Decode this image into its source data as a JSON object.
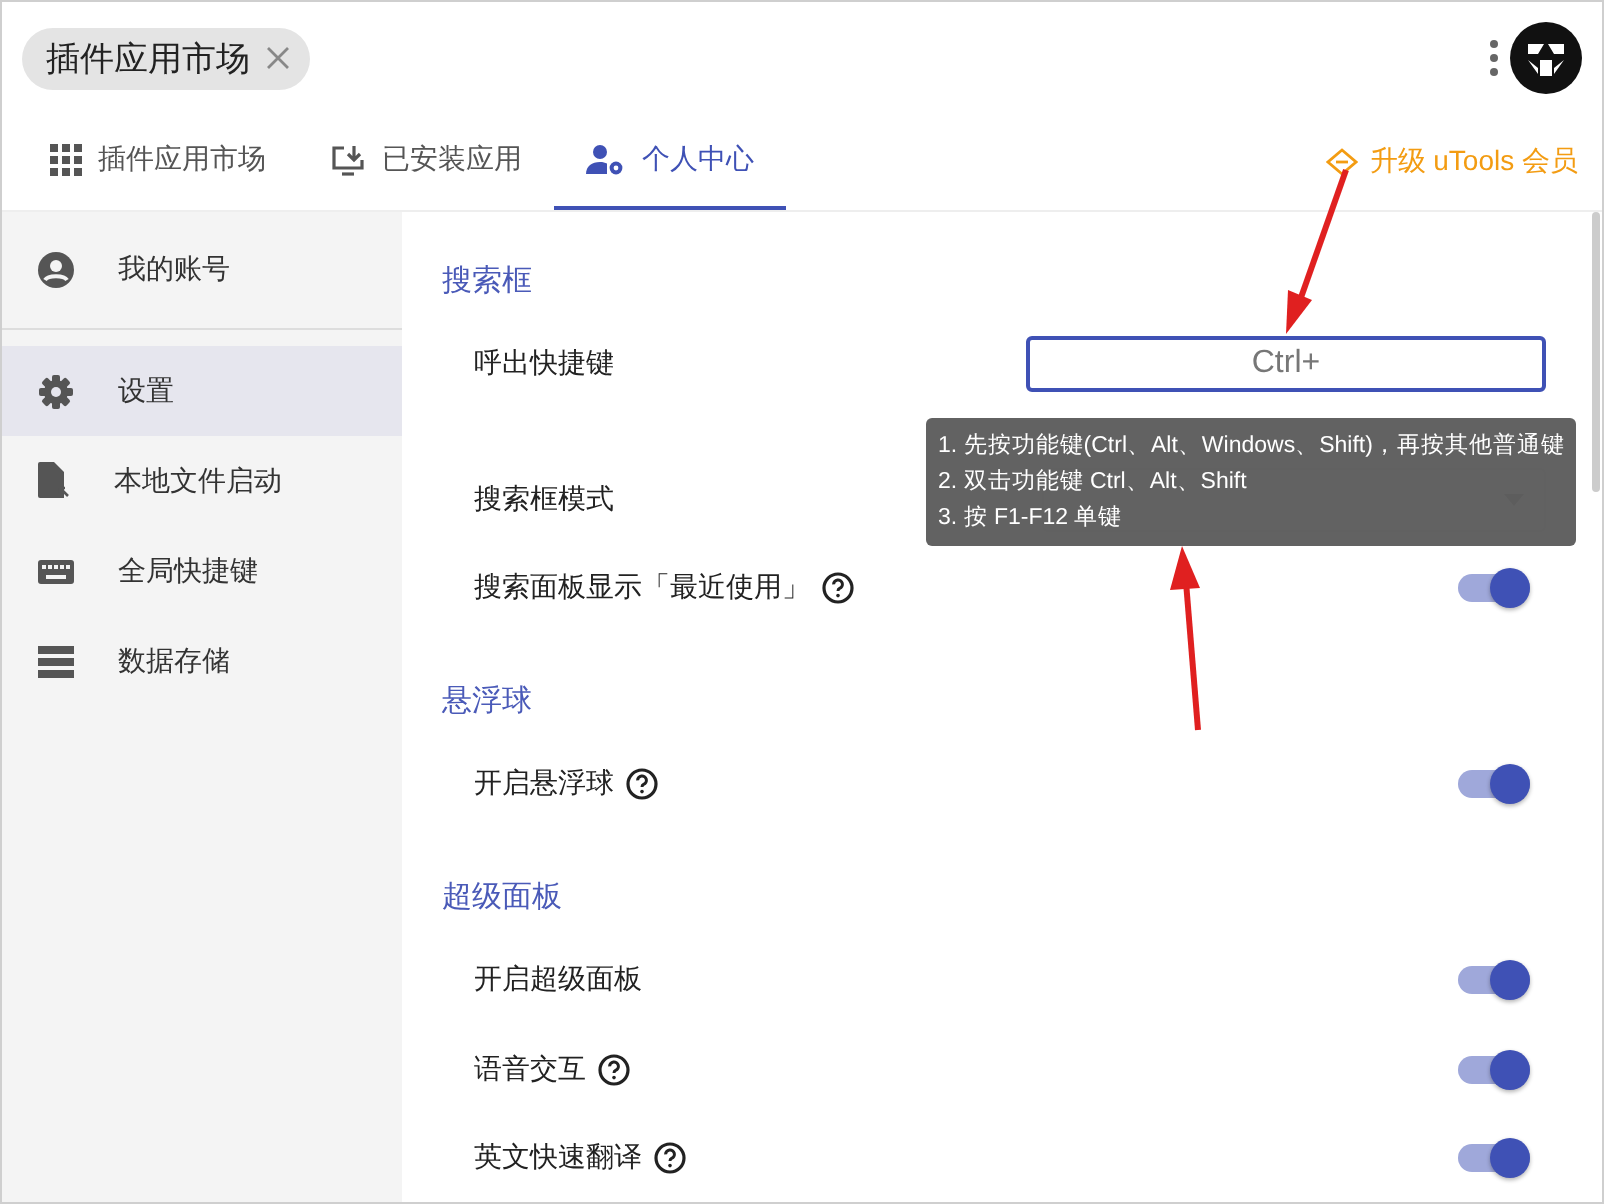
{
  "window": {
    "tab_title": "插件应用市场"
  },
  "tabs": [
    {
      "label": "插件应用市场",
      "selected": false
    },
    {
      "label": "已安装应用",
      "selected": false
    },
    {
      "label": "个人中心",
      "selected": true
    }
  ],
  "upgrade_link": "升级 uTools 会员",
  "sidebar": {
    "items": [
      {
        "label": "我的账号",
        "selected": false
      },
      {
        "label": "设置",
        "selected": true
      },
      {
        "label": "本地文件启动",
        "selected": false
      },
      {
        "label": "全局快捷键",
        "selected": false
      },
      {
        "label": "数据存储",
        "selected": false
      }
    ]
  },
  "sections": [
    {
      "title": "搜索框",
      "rows": [
        {
          "kind": "input",
          "label": "呼出快捷键",
          "value": "Ctrl+"
        },
        {
          "kind": "select",
          "label": "搜索框模式"
        },
        {
          "kind": "toggle",
          "label": "搜索面板显示「最近使用」",
          "help": true,
          "on": true
        }
      ]
    },
    {
      "title": "悬浮球",
      "rows": [
        {
          "kind": "toggle",
          "label": "开启悬浮球",
          "help": true,
          "on": true
        }
      ]
    },
    {
      "title": "超级面板",
      "rows": [
        {
          "kind": "toggle",
          "label": "开启超级面板",
          "help": false,
          "on": true
        },
        {
          "kind": "toggle",
          "label": "语音交互",
          "help": true,
          "on": true
        },
        {
          "kind": "toggle",
          "label": "英文快速翻译",
          "help": true,
          "on": true
        }
      ]
    }
  ],
  "tooltip": {
    "lines": [
      "1. 先按功能键(Ctrl、Alt、Windows、Shift)，再按其他普通键",
      "2. 双击功能键 Ctrl、Alt、Shift",
      "3. 按 F1-F12 单键"
    ]
  }
}
